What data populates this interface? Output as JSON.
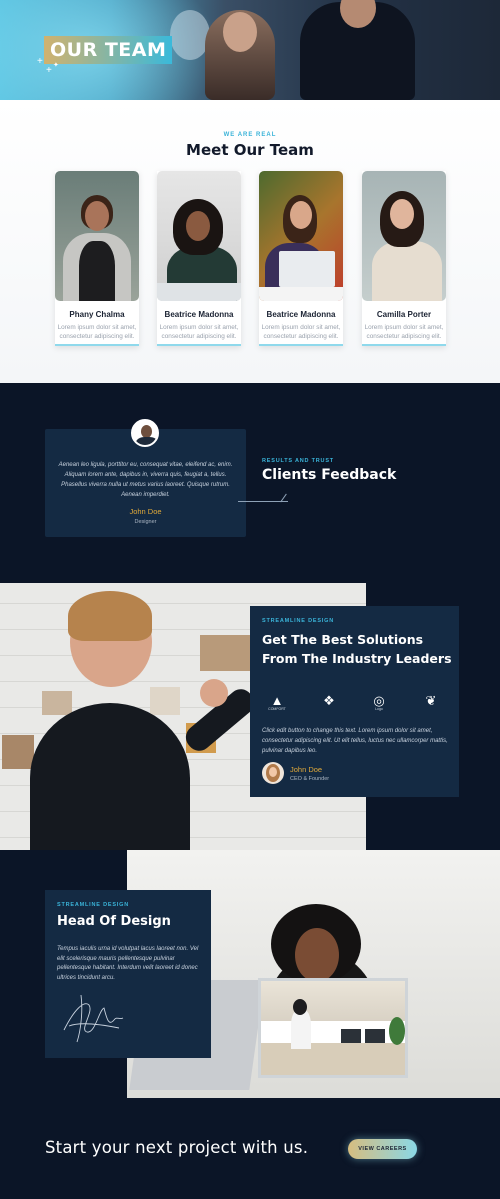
{
  "hero": {
    "title": "OUR TEAM"
  },
  "team": {
    "eyebrow": "WE ARE REAL",
    "heading": "Meet Our Team",
    "members": [
      {
        "name": "Phany Chalma",
        "desc": "Lorem ipsum dolor sit amet, consectetur adipiscing elit."
      },
      {
        "name": "Beatrice Madonna",
        "desc": "Lorem ipsum dolor sit amet, consectetur adipiscing elit."
      },
      {
        "name": "Beatrice Madonna",
        "desc": "Lorem ipsum dolor sit amet, consectetur adipiscing elit."
      },
      {
        "name": "Camilla Porter",
        "desc": "Lorem ipsum dolor sit amet, consectetur adipiscing elit."
      }
    ]
  },
  "feedback": {
    "quote": "Aenean leo ligula, porttitor eu, consequat vitae, eleifend ac, enim. Aliquam lorem ante, dapibus in, viverra quis, feugiat a, tellus. Phasellus viverra nulla ut metus varius laoreet. Quisque rutrum. Aenean imperdiet.",
    "name": "John Doe",
    "role": "Designer",
    "eyebrow": "RESULTS AND TRUST",
    "title": "Clients Feedback"
  },
  "solutions": {
    "eyebrow": "STREAMLINE DESIGN",
    "title": "Get The Best Solutions From The Industry Leaders",
    "logos": [
      {
        "icon": "mountain-logo-icon",
        "label": "COMFORT"
      },
      {
        "icon": "diamond-logo-icon",
        "label": ""
      },
      {
        "icon": "circle-logo-icon",
        "label": "Logo"
      },
      {
        "icon": "leaf-logo-icon",
        "label": ""
      }
    ],
    "text": "Click edit button to change this text. Lorem ipsum dolor sit amet, consectetur adipiscing elit. Ut elit tellus, luctus nec ullamcorper mattis, pulvinar dapibus leo.",
    "name": "John Doe",
    "role": "CEO & Founder"
  },
  "hod": {
    "eyebrow": "STREAMLINE DESIGN",
    "title": "Head Of Design",
    "text": "Tempus iaculis urna id volutpat lacus laoreet non. Vel elit scelerisque mauris pellentesque pulvinar pellentesque habitant. Interdum velit laoreet id donec ultrices tincidunt arcu."
  },
  "cta": {
    "text": "Start your next project with us.",
    "button": "VIEW CAREERS"
  },
  "colors": {
    "navy": "#0b1527",
    "panel": "#142a43",
    "accent": "#3ab3d8",
    "gold": "#e0a93a"
  }
}
